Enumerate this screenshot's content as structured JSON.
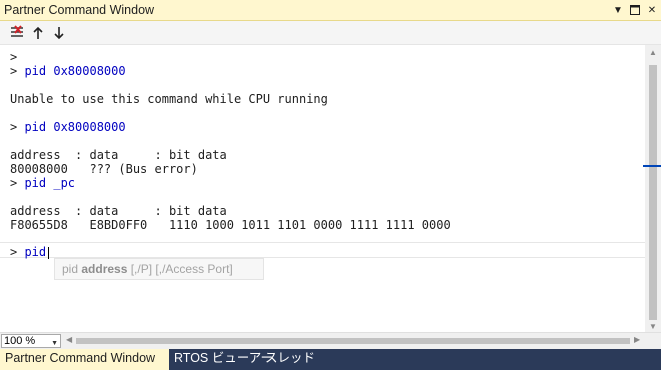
{
  "window": {
    "title": "Partner Command Window"
  },
  "toolbar": {
    "clear_icon": "clear-list-icon",
    "up_icon": "arrow-up-icon",
    "down_icon": "arrow-down-icon"
  },
  "console": {
    "lines": [
      ">",
      "> pid 0x80008000",
      "",
      "Unable to use this command while CPU running",
      "",
      "> pid 0x80008000",
      "",
      "address  : data     : bit data",
      "80008000   ??? (Bus error)",
      "> pid _pc",
      "",
      "address  : data     : bit data",
      "F80655D8   E8BD0FF0   1110 1000 1011 1101 0000 1111 1111 0000",
      "",
      "> pid"
    ],
    "hint_keyword": "address",
    "hint_prefix": "pid ",
    "hint_suffix": " [,/P] [,/Access Port]"
  },
  "status": {
    "zoom": "100 %"
  },
  "tabs": [
    {
      "label": "Partner Command Window",
      "active": true
    },
    {
      "label": "RTOS ビューアー",
      "active": false
    },
    {
      "label": "スレッド",
      "active": false
    }
  ],
  "colors": {
    "title_bg": "#fff7cf",
    "tabbar_bg": "#2b3a59",
    "command_text": "#0000c0"
  }
}
